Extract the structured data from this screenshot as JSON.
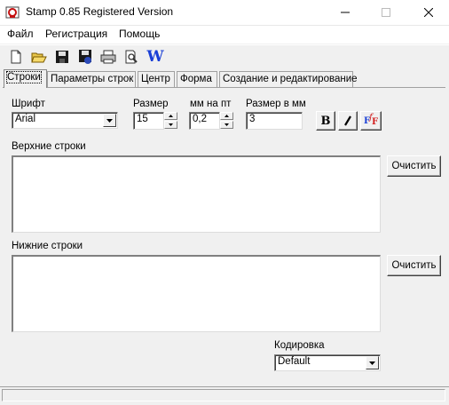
{
  "window": {
    "title": "Stamp 0.85 Registered Version"
  },
  "menu": {
    "items": [
      "Файл",
      "Регистрация",
      "Помощь"
    ]
  },
  "toolbar": {
    "icons": [
      "new-file-icon",
      "open-folder-icon",
      "save-icon",
      "save-as-icon",
      "print-icon",
      "print-preview-icon",
      "word-export-icon"
    ],
    "word_letter": "W"
  },
  "tabs": [
    "Строки",
    "Параметры строк",
    "Центр",
    "Форма",
    "Создание и редактирование"
  ],
  "font": {
    "label": "Шрифт",
    "value": "Arial"
  },
  "size": {
    "label": "Размер",
    "value": "15"
  },
  "mm_per_pt": {
    "label": "мм на пт",
    "value": "0,2"
  },
  "size_mm": {
    "label": "Размер в мм",
    "value": "3"
  },
  "style_buttons": {
    "bold": "B",
    "italic": "I",
    "font_a": "F",
    "font_b": "F"
  },
  "upper": {
    "label": "Верхние строки",
    "clear_button": "Очистить"
  },
  "lower": {
    "label": "Нижние строки",
    "clear_button": "Очистить"
  },
  "encoding": {
    "label": "Кодировка",
    "value": "Default"
  },
  "colors": {
    "accent_blue": "#1a3fd6",
    "red": "#d21f1f"
  }
}
